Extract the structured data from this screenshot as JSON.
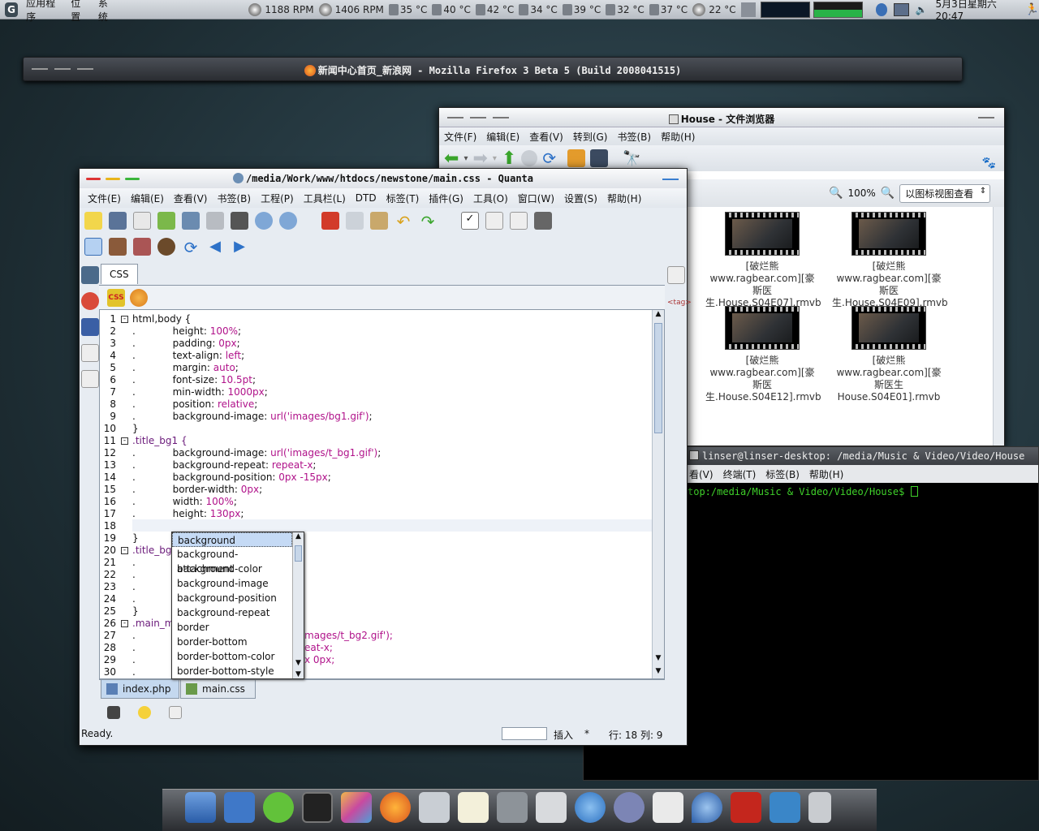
{
  "top_panel": {
    "menus": [
      "应用程序",
      "位置",
      "系统"
    ],
    "sensors": [
      "1188 RPM",
      "1406 RPM",
      "35 °C",
      "40 °C",
      "42 °C",
      "34 °C",
      "39 °C",
      "32 °C",
      "37 °C",
      "22 °C"
    ],
    "clock": "5月3日星期六 20:47"
  },
  "firefox": {
    "title": "新闻中心首页_新浪网 - Mozilla Firefox 3 Beta 5 (Build 2008041515)"
  },
  "filebrowser": {
    "title": "House - 文件浏览器",
    "menu": [
      "文件(F)",
      "编辑(E)",
      "查看(V)",
      "转到(G)",
      "书签(B)",
      "帮助(H)"
    ],
    "zoom": "100%",
    "view_mode": "以图标视图查看",
    "files": [
      "[破烂熊www.ragbear.com][豪斯医生.House.S04E07].rmvb",
      "[破烂熊www.ragbear.com][豪斯医生.House.S04E09].rmvb",
      "[破烂熊www.ragbear.com][豪斯医生.House.S04E12].rmvb",
      "[破烂熊www.ragbear.com][豪斯医生House.S04E01].rmvb"
    ]
  },
  "terminal": {
    "title": "linser@linser-desktop: /media/Music & Video/Video/House",
    "menu": [
      "看(V)",
      "终端(T)",
      "标签(B)",
      "帮助(H)"
    ],
    "prompt": "top:/media/Music & Video/Video/House$"
  },
  "quanta": {
    "title": "/media/Work/www/htdocs/newstone/main.css - Quanta",
    "menu": [
      "文件(E)",
      "编辑(E)",
      "查看(V)",
      "书签(B)",
      "工程(P)",
      "工具栏(L)",
      "DTD",
      "标签(T)",
      "插件(G)",
      "工具(O)",
      "窗口(W)",
      "设置(S)",
      "帮助(H)"
    ],
    "tab": "CSS",
    "side_tag": "<tag>",
    "lines": [
      {
        "n": "1",
        "fold": "-",
        "t": "html,body {",
        "c": "k"
      },
      {
        "n": "2",
        "t": ".\t\theight: ",
        "v": "100%",
        ";": ";"
      },
      {
        "n": "3",
        "t": ".\t\tpadding: ",
        "v": "0px"
      },
      {
        "n": "4",
        "t": ".\t\ttext-align: ",
        "v": "left"
      },
      {
        "n": "5",
        "t": ".\t\tmargin: ",
        "v": "auto"
      },
      {
        "n": "6",
        "t": ".\t\tfont-size: ",
        "v": "10.5pt"
      },
      {
        "n": "7",
        "t": ".\t\tmin-width: ",
        "v": "1000px"
      },
      {
        "n": "8",
        "t": ".\t\tposition: ",
        "v": "relative"
      },
      {
        "n": "9",
        "t": ".\t\tbackground-image: ",
        "v": "url('images/bg1.gif')"
      },
      {
        "n": "10",
        "t": "}"
      },
      {
        "n": "11",
        "fold": "-",
        "t": ".title_bg1 {",
        "c": "sel"
      },
      {
        "n": "12",
        "t": ".\t\tbackground-image: ",
        "v": "url('images/t_bg1.gif')"
      },
      {
        "n": "13",
        "t": ".\t\tbackground-repeat: ",
        "v": "repeat-x"
      },
      {
        "n": "14",
        "t": ".\t\tbackground-position: ",
        "v": "0px -15px"
      },
      {
        "n": "15",
        "t": ".\t\tborder-width: ",
        "v": "0px"
      },
      {
        "n": "16",
        "t": ".\t\twidth: ",
        "v": "100%"
      },
      {
        "n": "17",
        "t": ".\t\theight: ",
        "v": "130px"
      },
      {
        "n": "18",
        "t": "."
      },
      {
        "n": "19",
        "t": "}"
      },
      {
        "n": "20",
        "fold": "-",
        "t": ".title_bg",
        "c": "sel"
      },
      {
        "n": "21",
        "t": "."
      },
      {
        "n": "22",
        "t": "."
      },
      {
        "n": "23",
        "t": "."
      },
      {
        "n": "24",
        "t": "."
      },
      {
        "n": "25",
        "t": "}"
      },
      {
        "n": "26",
        "fold": "-",
        "t": ".main_m",
        "c": "sel"
      },
      {
        "n": "27",
        "t": ".",
        "tail": "mages/t_bg2.gif');"
      },
      {
        "n": "28",
        "t": ".",
        "tail": "eat-x;"
      },
      {
        "n": "29",
        "t": ".",
        "tail": "x 0px;"
      },
      {
        "n": "30",
        "t": "."
      }
    ],
    "autocomplete": [
      "background",
      "background-attachment",
      "background-color",
      "background-image",
      "background-position",
      "background-repeat",
      "border",
      "border-bottom",
      "border-bottom-color",
      "border-bottom-style"
    ],
    "doc_tabs": [
      "index.php",
      "main.css"
    ],
    "status": {
      "ready": "Ready.",
      "mode": "插入",
      "mod": "*",
      "pos": "行: 18 列: 9"
    }
  }
}
